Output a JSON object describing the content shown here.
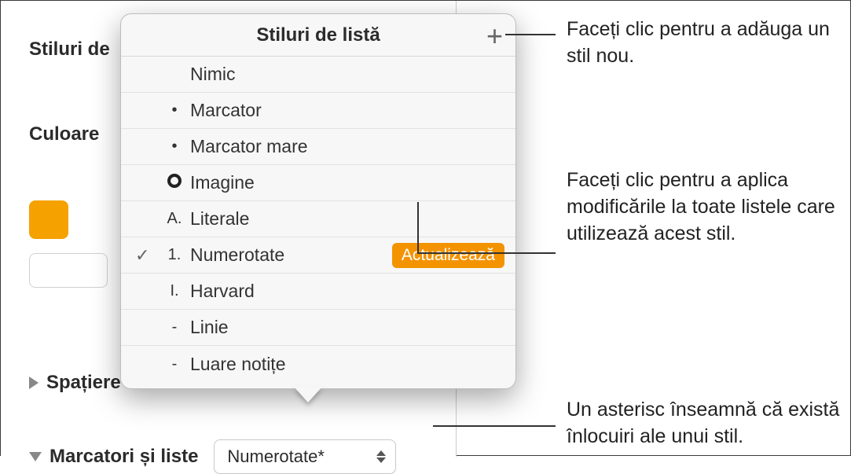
{
  "sidebar": {
    "stiluri_label": "Stiluri de",
    "culoare_label": "Culoare",
    "spatiere_label": "Spațiere",
    "marcatori_label": "Marcatori și liste",
    "dropdown_value": "Numerotate*"
  },
  "popover": {
    "title": "Stiluri de listă",
    "plus": "+",
    "items": [
      {
        "bullet": "",
        "label": "Nimic",
        "checked": false
      },
      {
        "bullet": "•",
        "label": "Marcator",
        "checked": false
      },
      {
        "bullet": "•",
        "label": "Marcator mare",
        "checked": false
      },
      {
        "bullet": "ring",
        "label": "Imagine",
        "checked": false
      },
      {
        "bullet": "A.",
        "label": "Literale",
        "checked": false
      },
      {
        "bullet": "1.",
        "label": "Numerotate",
        "checked": true,
        "update": true
      },
      {
        "bullet": "I.",
        "label": "Harvard",
        "checked": false
      },
      {
        "bullet": "-",
        "label": "Linie",
        "checked": false
      },
      {
        "bullet": "-",
        "label": "Luare notițe",
        "checked": false
      }
    ],
    "update_label": "Actualizează"
  },
  "callouts": {
    "c1": "Faceți clic pentru a adăuga un stil nou.",
    "c2": "Faceți clic pentru a aplica modificările la toate listele care utilizează acest stil.",
    "c3": "Un asterisc înseamnă că există înlocuiri ale unui stil."
  }
}
